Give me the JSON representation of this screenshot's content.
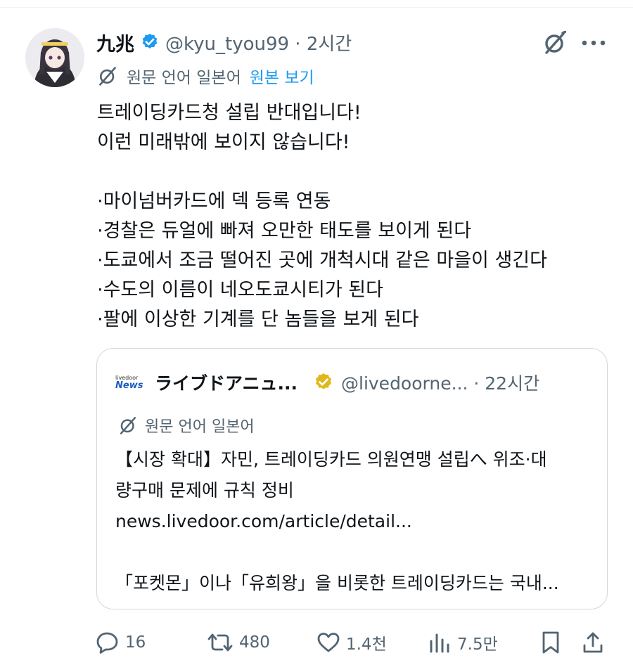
{
  "tweet": {
    "author_name": "九兆",
    "handle": "@kyu_tyou99 · 2시간",
    "translation_label": "원문 언어 일본어",
    "translation_link": "원본 보기",
    "lines": [
      "트레이딩카드청 설립 반대입니다!",
      "이런 미래밖에 보이지 않습니다!",
      "",
      "·마이넘버카드에 덱 등록 연동",
      "·경찰은 듀얼에 빠져 오만한 태도를 보이게 된다",
      "·도쿄에서 조금 떨어진 곳에 개척시대 같은 마을이 생긴다",
      "·수도의 이름이 네오도쿄시티가 된다",
      "·팔에 이상한 기계를 단 놈들을 보게 된다"
    ]
  },
  "quote": {
    "logo_small": "livedoor",
    "logo_main": "News",
    "name": "ライブドアニュ...",
    "handle": "@livedoorne... · 22시간",
    "translation_label": "원문 언어 일본어",
    "lines": [
      "【시장 확대】자민, 트레이딩카드 의원연맹 설립へ 위조·대",
      "량구매 문제에 규칙 정비",
      "news.livedoor.com/article/detail...",
      "",
      "「포켓몬」이나「유희왕」을 비롯한 트레이딩카드는 국내..."
    ]
  },
  "actions": {
    "reply_count": "16",
    "retweet_count": "480",
    "like_count": "1.4천",
    "view_count": "7.5만"
  },
  "colors": {
    "accent": "#1d9bf0",
    "secondary_text": "#536471",
    "border": "#cfd9de",
    "gold_badge": "#e2b719"
  },
  "icons": [
    "avatar",
    "verified-badge-icon",
    "grok-icon",
    "more-icon",
    "translate-icon",
    "gold-verified-badge-icon",
    "reply-icon",
    "retweet-icon",
    "like-icon",
    "views-icon",
    "bookmark-icon",
    "share-icon"
  ]
}
